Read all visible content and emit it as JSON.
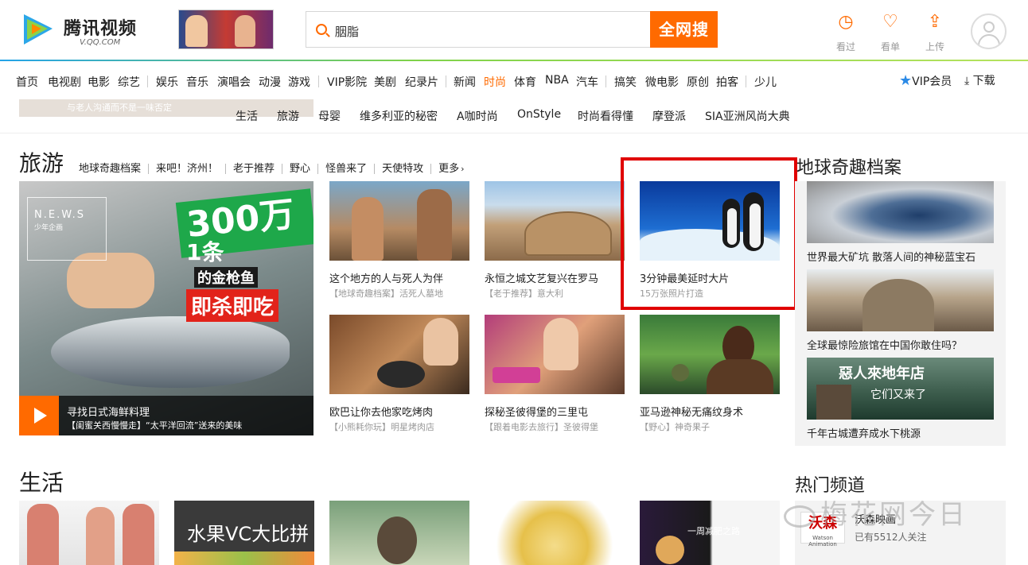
{
  "header": {
    "logo_name": "腾讯视频",
    "logo_sub": "V.QQ.COM",
    "search_value": "胭脂",
    "search_button": "全网搜",
    "icons": [
      {
        "icon": "history-icon",
        "label": "看过"
      },
      {
        "icon": "watchlist-icon",
        "label": "看单"
      },
      {
        "icon": "upload-icon",
        "label": "上传"
      }
    ]
  },
  "nav": {
    "items": [
      "首页",
      "电视剧",
      "电影",
      "综艺",
      "娱乐",
      "音乐",
      "演唱会",
      "动漫",
      "游戏",
      "VIP影院",
      "美剧",
      "纪录片",
      "新闻",
      "时尚",
      "体育",
      "NBA",
      "汽车",
      "搞笑",
      "微电影",
      "原创",
      "拍客",
      "少儿"
    ],
    "active": "时尚",
    "vip": "VIP会员",
    "download": "下载"
  },
  "subnav": {
    "items": [
      "生活",
      "旅游",
      "母婴",
      "维多利亚的秘密",
      "A咖时尚",
      "OnStyle",
      "时尚看得懂",
      "摩登派",
      "SIA亚洲风尚大典"
    ],
    "ghost_text": "与老人沟通而不是一味否定"
  },
  "travel": {
    "title": "旅游",
    "tags": [
      "地球奇趣档案",
      "来吧！济州！",
      "老于推荐",
      "野心",
      "怪兽来了",
      "天使特攻",
      "更多"
    ],
    "big": {
      "caption1": "寻找日式海鲜料理",
      "caption2": "【闺蜜关西慢慢走】“太平洋回流”送来的美味",
      "news_badge": "N.E.W.S",
      "news_sub": "少年企画",
      "n300": "300万",
      "one": "1条",
      "gold": "的金枪鱼",
      "kill": "即杀即吃"
    },
    "cards": [
      {
        "title": "这个地方的人与死人为伴",
        "sub": "【地球奇趣档案】活死人墓地"
      },
      {
        "title": "永恒之城文艺复兴在罗马",
        "sub": "【老于推荐】意大利"
      },
      {
        "title": "3分钟最美延时大片",
        "sub": "15万张照片打造"
      },
      {
        "title": "欧巴让你去他家吃烤肉",
        "sub": "【小熊耗你玩】明星烤肉店"
      },
      {
        "title": "探秘圣彼得堡的三里屯",
        "sub": "【跟着电影去旅行】圣彼得堡"
      },
      {
        "title": "亚马逊神秘无痛纹身术",
        "sub": "【野心】神奇果子"
      }
    ]
  },
  "sidebar": {
    "title": "地球奇趣档案",
    "items": [
      {
        "caption": "世界最大矿坑 散落人间的神秘蓝宝石"
      },
      {
        "caption": "全球最惊险旅馆在中国你敢住吗？"
      },
      {
        "caption": "千年古城遭弃成水下桃源",
        "overlay": "惡人來地年店",
        "overlay2": "它们又来了"
      }
    ]
  },
  "life": {
    "title": "生活",
    "card2_text": "水果VC大比拼",
    "card5_text": "一周减肥之路"
  },
  "hot": {
    "title": "热门频道",
    "channel_logo": "沃森",
    "channel_logo_sub": "Watson Animation",
    "channel_name": "沃森映画",
    "followers": "已有5512人关注"
  },
  "watermark": "梅花网今日",
  "colors": {
    "accent": "#ff6a00",
    "highlight_box": "#e00000"
  }
}
